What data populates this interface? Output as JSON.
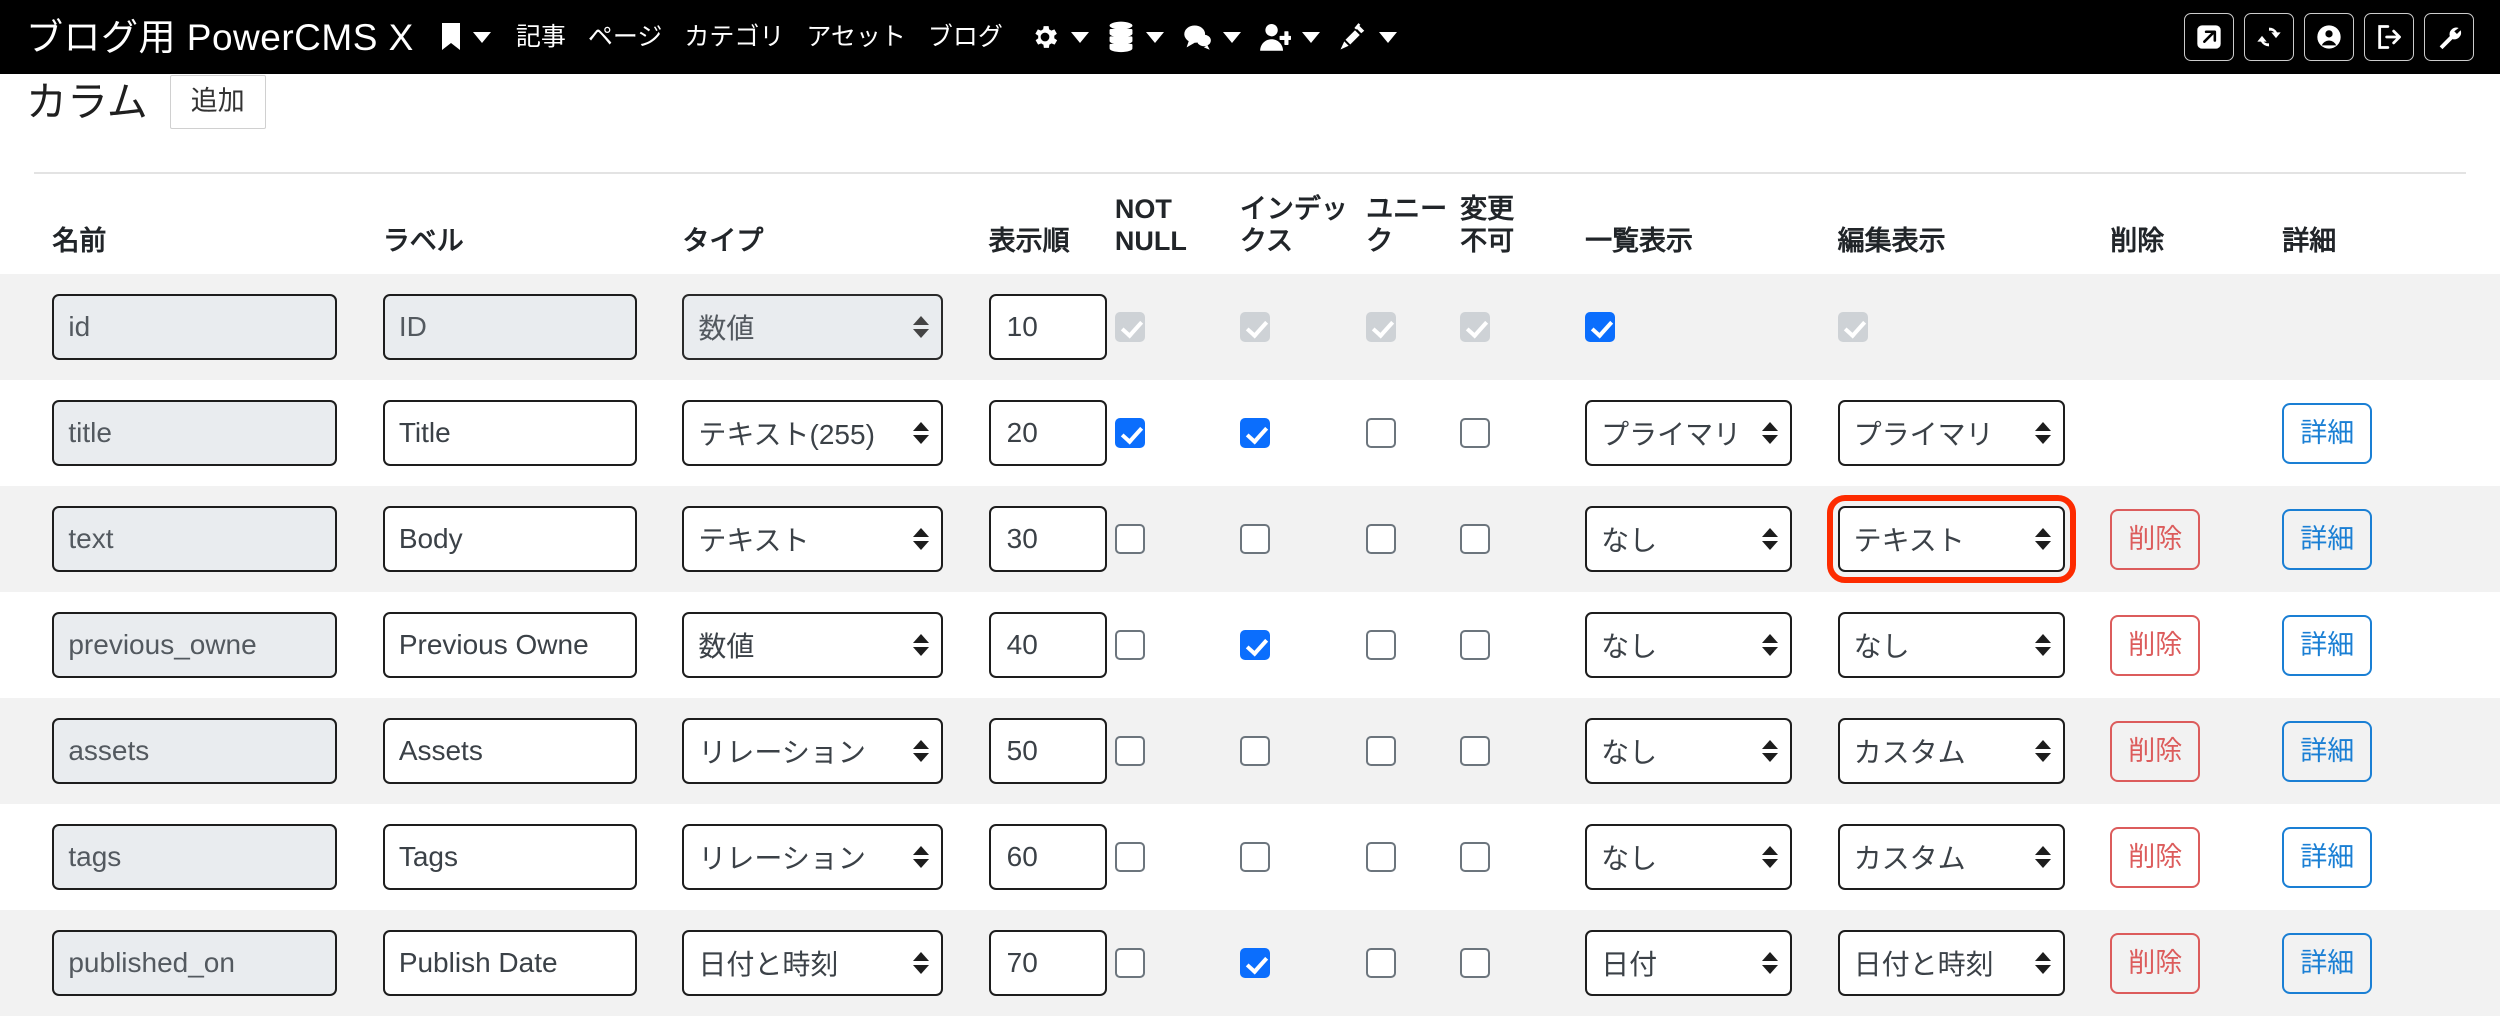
{
  "navbar": {
    "brand": "ブログ用 PowerCMS X",
    "bookmark_icon": "bookmark-icon",
    "menu_items": [
      {
        "label": "記事"
      },
      {
        "label": "ページ"
      },
      {
        "label": "カテゴリ"
      },
      {
        "label": "アセット"
      },
      {
        "label": "ブログ"
      }
    ],
    "icon_menus": [
      {
        "icon": "gear-icon"
      },
      {
        "icon": "database-icon"
      },
      {
        "icon": "comment-icon"
      },
      {
        "icon": "user-add-icon"
      },
      {
        "icon": "plug-icon"
      }
    ],
    "right_buttons": [
      {
        "icon": "external-link-icon"
      },
      {
        "icon": "refresh-icon"
      },
      {
        "icon": "user-circle-icon"
      },
      {
        "icon": "logout-icon"
      },
      {
        "icon": "wrench-icon"
      }
    ]
  },
  "page": {
    "title": "カラム",
    "add_label": "追加"
  },
  "table": {
    "headers": {
      "name": "名前",
      "label": "ラベル",
      "type": "タイプ",
      "order": "表示順",
      "not_null_line1": "NOT",
      "not_null_line2": "NULL",
      "index_line1": "インデッ",
      "index_line2": "クス",
      "unique_line1": "ユニー",
      "unique_line2": "ク",
      "nochange_line1": "変更",
      "nochange_line2": "不可",
      "list_display": "一覧表示",
      "edit_display": "編集表示",
      "delete": "削除",
      "detail": "詳細"
    },
    "action_labels": {
      "delete": "削除",
      "detail": "詳細"
    },
    "rows": [
      {
        "name": "id",
        "label": "ID",
        "type": "数値",
        "order": "10",
        "not_null": {
          "checked": true,
          "disabled": true
        },
        "index": {
          "checked": true,
          "disabled": true
        },
        "unique": {
          "checked": true,
          "disabled": true
        },
        "nochange": {
          "checked": true,
          "disabled": true
        },
        "list_display": "",
        "list_display_is_checkbox": true,
        "list_checkbox": {
          "checked": true,
          "disabled": false
        },
        "edit_display": "",
        "edit_display_is_checkbox": true,
        "edit_checkbox": {
          "checked": true,
          "disabled": true
        },
        "readonly": true,
        "has_delete": false,
        "has_detail": false,
        "highlight_edit": false
      },
      {
        "name": "title",
        "label": "Title",
        "type": "テキスト(255)",
        "order": "20",
        "not_null": {
          "checked": true,
          "disabled": false
        },
        "index": {
          "checked": true,
          "disabled": false
        },
        "unique": {
          "checked": false,
          "disabled": false
        },
        "nochange": {
          "checked": false,
          "disabled": false
        },
        "list_display": "プライマリ",
        "edit_display": "プライマリ",
        "readonly": false,
        "has_delete": false,
        "has_detail": true,
        "highlight_edit": false
      },
      {
        "name": "text",
        "label": "Body",
        "type": "テキスト",
        "order": "30",
        "not_null": {
          "checked": false,
          "disabled": false
        },
        "index": {
          "checked": false,
          "disabled": false
        },
        "unique": {
          "checked": false,
          "disabled": false
        },
        "nochange": {
          "checked": false,
          "disabled": false
        },
        "list_display": "なし",
        "edit_display": "テキスト",
        "readonly": false,
        "has_delete": true,
        "has_detail": true,
        "highlight_edit": true
      },
      {
        "name": "previous_owne",
        "label": "Previous Owne",
        "type": "数値",
        "order": "40",
        "not_null": {
          "checked": false,
          "disabled": false
        },
        "index": {
          "checked": true,
          "disabled": false
        },
        "unique": {
          "checked": false,
          "disabled": false
        },
        "nochange": {
          "checked": false,
          "disabled": false
        },
        "list_display": "なし",
        "edit_display": "なし",
        "readonly": false,
        "has_delete": true,
        "has_detail": true,
        "highlight_edit": false
      },
      {
        "name": "assets",
        "label": "Assets",
        "type": "リレーション",
        "order": "50",
        "not_null": {
          "checked": false,
          "disabled": false
        },
        "index": {
          "checked": false,
          "disabled": false
        },
        "unique": {
          "checked": false,
          "disabled": false
        },
        "nochange": {
          "checked": false,
          "disabled": false
        },
        "list_display": "なし",
        "edit_display": "カスタム",
        "readonly": false,
        "has_delete": true,
        "has_detail": true,
        "highlight_edit": false
      },
      {
        "name": "tags",
        "label": "Tags",
        "type": "リレーション",
        "order": "60",
        "not_null": {
          "checked": false,
          "disabled": false
        },
        "index": {
          "checked": false,
          "disabled": false
        },
        "unique": {
          "checked": false,
          "disabled": false
        },
        "nochange": {
          "checked": false,
          "disabled": false
        },
        "list_display": "なし",
        "edit_display": "カスタム",
        "readonly": false,
        "has_delete": true,
        "has_detail": true,
        "highlight_edit": false
      },
      {
        "name": "published_on",
        "label": "Publish Date",
        "type": "日付と時刻",
        "order": "70",
        "not_null": {
          "checked": false,
          "disabled": false
        },
        "index": {
          "checked": true,
          "disabled": false
        },
        "unique": {
          "checked": false,
          "disabled": false
        },
        "nochange": {
          "checked": false,
          "disabled": false
        },
        "list_display": "日付",
        "edit_display": "日付と時刻",
        "readonly": false,
        "has_delete": true,
        "has_detail": true,
        "highlight_edit": false
      }
    ]
  },
  "colors": {
    "navbar_bg": "#000000",
    "accent_blue": "#0b6efd",
    "highlight_red": "#fd2b00",
    "delete_red": "#dc5c5c",
    "detail_blue": "#1a7fd4",
    "zebra_bg": "#f2f2f2"
  }
}
